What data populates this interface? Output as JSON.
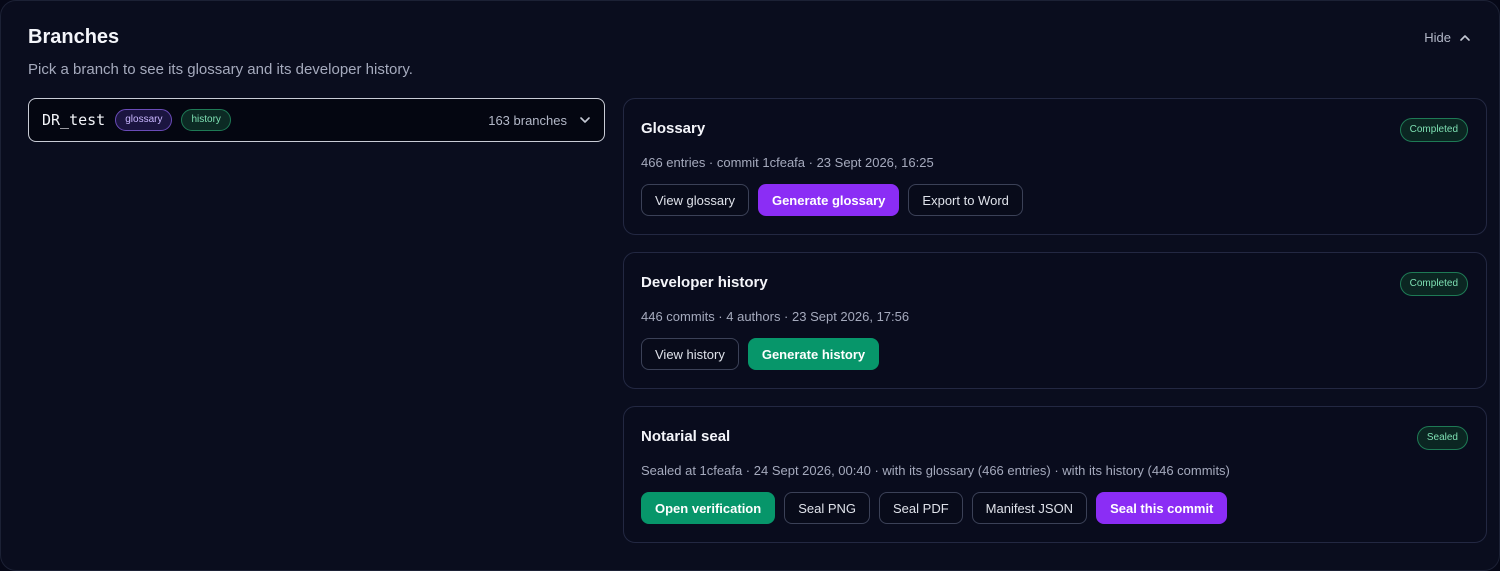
{
  "header": {
    "title": "Branches",
    "subtitle": "Pick a branch to see its glossary and its developer history.",
    "hide_label": "Hide"
  },
  "branch_selector": {
    "selected": "DR_test",
    "tags": [
      "glossary",
      "history"
    ],
    "count_label": "163 branches"
  },
  "glossary": {
    "title": "Glossary",
    "meta": "466 entries · commit 1cfeafa · 23 Sept 2026, 16:25",
    "status": "Completed",
    "buttons": {
      "view": "View glossary",
      "generate": "Generate glossary",
      "export": "Export to Word"
    }
  },
  "history": {
    "title": "Developer history",
    "meta": "446 commits · 4 authors · 23 Sept 2026, 17:56",
    "status": "Completed",
    "buttons": {
      "view": "View history",
      "generate": "Generate history"
    }
  },
  "seal": {
    "title": "Notarial seal",
    "meta": "Sealed at 1cfeafa · 24 Sept 2026, 00:40 · with its glossary (466 entries) · with its history (446 commits)",
    "status": "Sealed",
    "buttons": {
      "verify": "Open verification",
      "png": "Seal PNG",
      "pdf": "Seal PDF",
      "manifest": "Manifest JSON",
      "seal": "Seal this commit"
    }
  },
  "colors": {
    "accent_purple": "#8b2df5",
    "accent_green": "#07966a",
    "background": "#0a0d1e"
  }
}
